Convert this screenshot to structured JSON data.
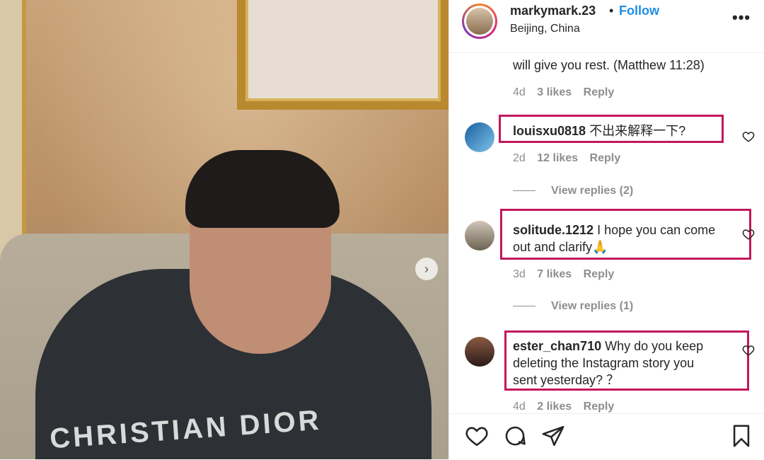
{
  "post": {
    "username": "markymark.23",
    "separator": "•",
    "follow_label": "Follow",
    "location": "Beijing, China",
    "more_label": "•••",
    "photo_text": "CHRISTIAN DIOR",
    "carousel_next": "›"
  },
  "comments": [
    {
      "text": "will give you rest. (Matthew 11:28)",
      "time": "4d",
      "likes": "3 likes",
      "reply": "Reply"
    },
    {
      "user": "louisxu0818",
      "text": "不出来解释一下?",
      "time": "2d",
      "likes": "12 likes",
      "reply": "Reply",
      "view_replies": "View replies (2)"
    },
    {
      "user": "solitude.1212",
      "text_line1": "I hope you can come",
      "text_line2": "out and clarify🙏",
      "time": "3d",
      "likes": "7 likes",
      "reply": "Reply",
      "view_replies": "View replies (1)"
    },
    {
      "user": "ester_chan710",
      "text_line1": "Why do you keep",
      "text_line2": "deleting the Instagram story you",
      "text_line3": "sent yesterday? ？",
      "time": "4d",
      "likes": "2 likes",
      "reply": "Reply"
    }
  ],
  "colors": {
    "follow": "#1e8fe6",
    "highlight": "#c2185b",
    "meta": "#8e8e8e"
  },
  "icons": [
    "heart-icon",
    "comment-icon",
    "share-icon",
    "bookmark-icon",
    "more-icon",
    "chevron-right-icon"
  ]
}
